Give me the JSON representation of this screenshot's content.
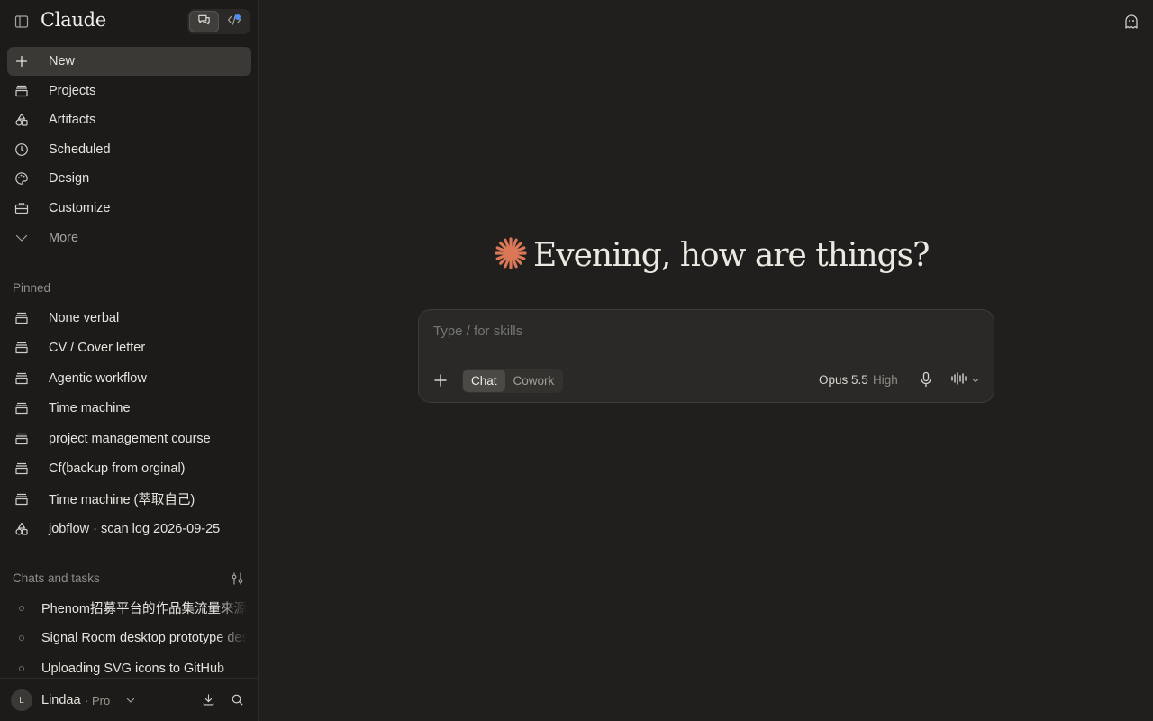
{
  "app": {
    "logo": "Claude"
  },
  "nav": {
    "new_label": "New",
    "projects_label": "Projects",
    "artifacts_label": "Artifacts",
    "scheduled_label": "Scheduled",
    "design_label": "Design",
    "customize_label": "Customize",
    "more_label": "More"
  },
  "pinned": {
    "title": "Pinned",
    "items": [
      "None verbal",
      "CV / Cover letter",
      "Agentic workflow",
      "Time machine",
      "project management course",
      "Cf(backup from orginal)",
      "Time machine (萃取自己)",
      "jobflow · scan log 2026-09-25"
    ]
  },
  "chats": {
    "title": "Chats and tasks",
    "items": [
      "Phenom招募平台的作品集流量來源",
      "Signal Room desktop prototype design",
      "Uploading SVG icons to GitHub"
    ]
  },
  "user": {
    "initial": "L",
    "name": "Lindaa",
    "plan": "· Pro"
  },
  "main": {
    "greeting": "Evening, how are things?",
    "composer": {
      "placeholder": "Type / for skills",
      "mode_chat": "Chat",
      "mode_cowork": "Cowork",
      "model": "Opus 5.5",
      "effort": "High"
    }
  },
  "colors": {
    "accent": "#d97757",
    "sidebar_bg": "#1c1b1a",
    "main_bg": "#201f1e",
    "selected_bg": "#3a3936"
  },
  "icons": [
    "sidebar-toggle-icon",
    "chat-icon",
    "code-icon",
    "plus-icon",
    "projects-icon",
    "artifacts-icon",
    "clock-icon",
    "palette-icon",
    "briefcase-icon",
    "chevron-down-icon",
    "filter-icon",
    "download-icon",
    "search-icon",
    "incognito-icon",
    "mic-icon",
    "waveform-icon",
    "claude-spark-icon"
  ]
}
